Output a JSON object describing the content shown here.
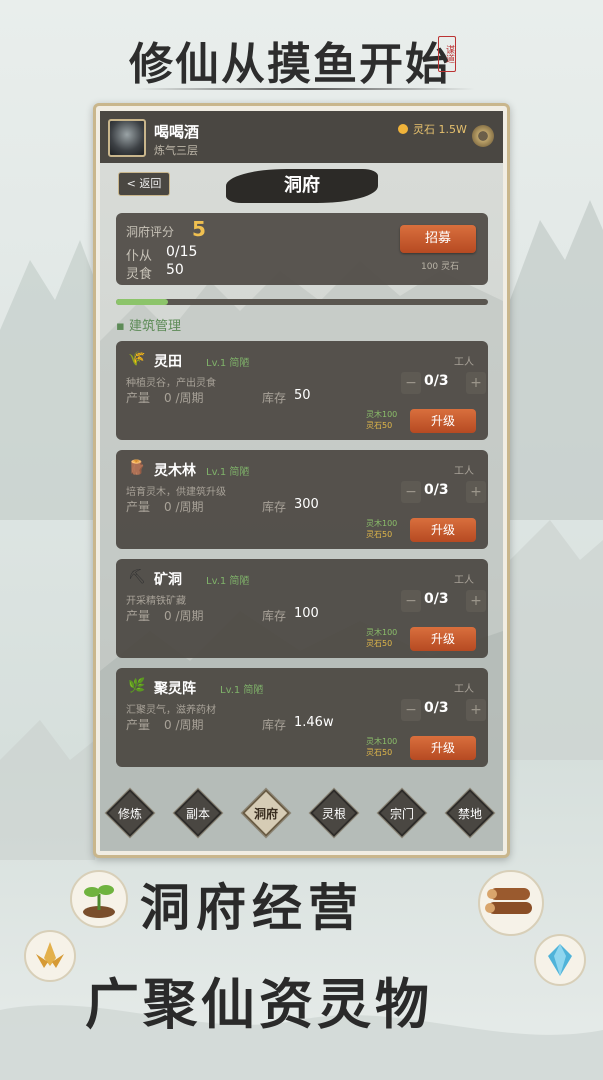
{
  "banner": {
    "title": "修仙从摸鱼开始",
    "seal": "谋道"
  },
  "profile": {
    "name": "喝喝酒",
    "realm": "炼气三层",
    "spirit_stone": "灵石 1.5W"
  },
  "header": {
    "back_label": "< 返回",
    "title": "洞府"
  },
  "summary": {
    "score_label": "洞府评分",
    "score_value": "5",
    "servant_label": "仆从",
    "servant_value": "0/15",
    "food_label": "灵食",
    "food_value": "50",
    "recruit_label": "招募",
    "recruit_cost": "100 灵石"
  },
  "progress": {
    "value": 0.14
  },
  "section_title": "建筑管理",
  "buildings": [
    {
      "name": "灵田",
      "icon": "rice-icon",
      "level": "Lv.1 简陋",
      "desc": "种植灵谷，产出灵食",
      "prod_label": "产量",
      "prod_value": "0 /周期",
      "stock_label": "库存",
      "stock_value": "50",
      "worker_label": "工人",
      "workers": "0/3",
      "cost_wood": "灵木100",
      "cost_stone": "灵石50",
      "upgrade_label": "升级"
    },
    {
      "name": "灵木林",
      "icon": "log-icon",
      "level": "Lv.1 简陋",
      "desc": "培育灵木，供建筑升级",
      "prod_label": "产量",
      "prod_value": "0 /周期",
      "stock_label": "库存",
      "stock_value": "300",
      "worker_label": "工人",
      "workers": "0/3",
      "cost_wood": "灵木100",
      "cost_stone": "灵石50",
      "upgrade_label": "升级"
    },
    {
      "name": "矿洞",
      "icon": "pickaxe-icon",
      "level": "Lv.1 简陋",
      "desc": "开采精铁矿藏",
      "prod_label": "产量",
      "prod_value": "0 /周期",
      "stock_label": "库存",
      "stock_value": "100",
      "worker_label": "工人",
      "workers": "0/3",
      "cost_wood": "灵木100",
      "cost_stone": "灵石50",
      "upgrade_label": "升级"
    },
    {
      "name": "聚灵阵",
      "icon": "herb-icon",
      "level": "Lv.1 简陋",
      "desc": "汇聚灵气，滋养药材",
      "prod_label": "产量",
      "prod_value": "0 /周期",
      "stock_label": "库存",
      "stock_value": "1.46w",
      "worker_label": "工人",
      "workers": "0/3",
      "cost_wood": "灵木100",
      "cost_stone": "灵石50",
      "upgrade_label": "升级"
    }
  ],
  "nav": [
    {
      "label": "修炼",
      "active": false
    },
    {
      "label": "副本",
      "active": false
    },
    {
      "label": "洞府",
      "active": true
    },
    {
      "label": "灵根",
      "active": false
    },
    {
      "label": "宗门",
      "active": false
    },
    {
      "label": "禁地",
      "active": false
    }
  ],
  "tagline": {
    "line1": "洞府经营",
    "line2": "广聚仙资灵物"
  },
  "colors": {
    "accent": "#c0552c",
    "gold": "#f0c050",
    "green": "#7fb26a",
    "panel": "#48443e"
  }
}
